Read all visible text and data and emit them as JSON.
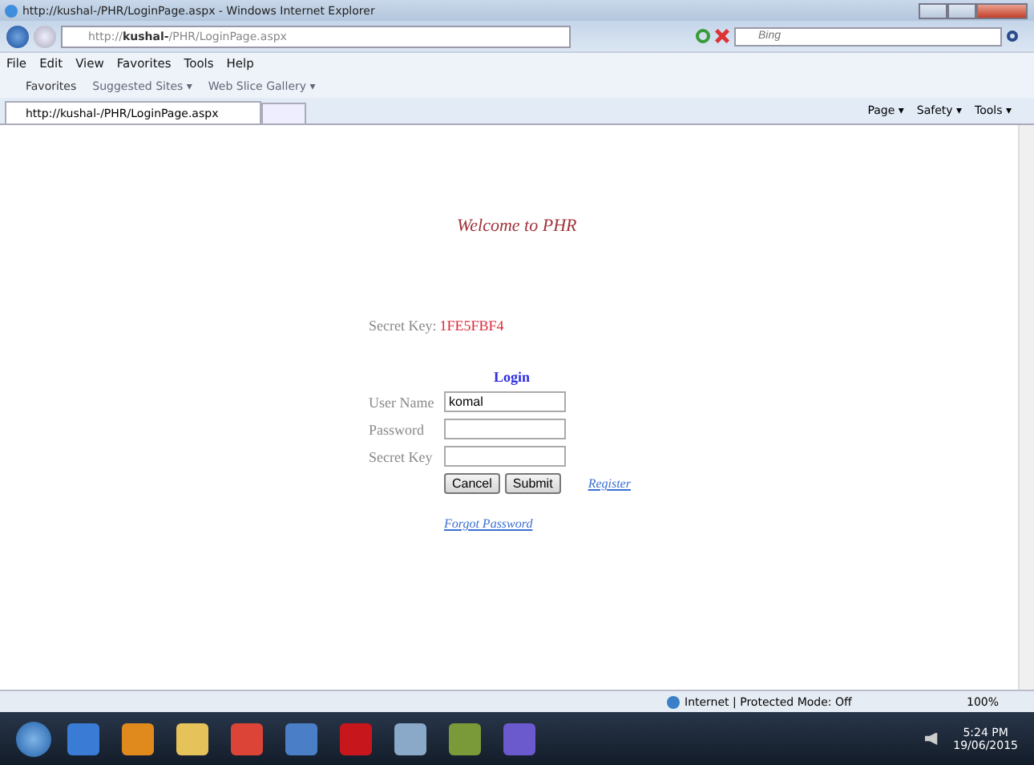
{
  "window": {
    "title": "http://kushal-/PHR/LoginPage.aspx - Windows Internet Explorer"
  },
  "address_bar": {
    "url_prefix": "http://",
    "url_host": "kushal-",
    "url_path": "/PHR/LoginPage.aspx"
  },
  "search": {
    "placeholder": "Bing"
  },
  "menu": [
    "File",
    "Edit",
    "View",
    "Favorites",
    "Tools",
    "Help"
  ],
  "favorites_bar": {
    "label": "Favorites",
    "links": [
      "Suggested Sites ▾",
      "Web Slice Gallery ▾"
    ]
  },
  "tabs": [
    {
      "label": "http://kushal-/PHR/LoginPage.aspx",
      "selected": true
    }
  ],
  "command_bar": [
    "Page ▾",
    "Safety ▾",
    "Tools ▾"
  ],
  "page": {
    "welcome": "Welcome to PHR",
    "secret_key_label": "Secret Key:",
    "secret_key_value": "1FE5FBF4",
    "login_title": "Login",
    "fields": [
      {
        "label": "User Name",
        "value": "komal"
      },
      {
        "label": "Password"
      },
      {
        "label": "Secret Key"
      }
    ],
    "buttons": [
      "Cancel",
      "Submit"
    ],
    "register_link": "Register",
    "forgot_link": "Forgot Password"
  },
  "status_bar": {
    "zone": "Internet | Protected Mode: Off",
    "zoom": "100%"
  },
  "taskbar": {
    "time": "5:24 PM",
    "date": "19/06/2015"
  }
}
